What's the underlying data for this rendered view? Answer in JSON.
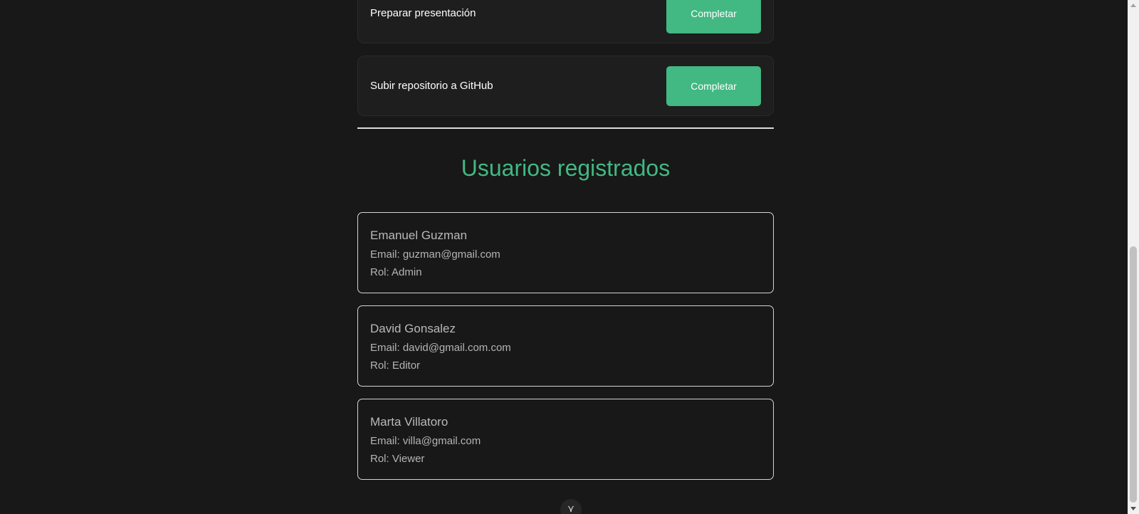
{
  "tasks": [
    {
      "label": "Preparar presentación",
      "button": "Completar"
    },
    {
      "label": "Subir repositorio a GitHub",
      "button": "Completar"
    }
  ],
  "users_section": {
    "title": "Usuarios registrados",
    "users": [
      {
        "name": "Emanuel Guzman",
        "email": "Email: guzman@gmail.com",
        "role": "Rol: Admin"
      },
      {
        "name": "David Gonsalez",
        "email": "Email: david@gmail.com.com",
        "role": "Rol: Editor"
      },
      {
        "name": "Marta Villatoro",
        "email": "Email: villa@gmail.com",
        "role": "Rol: Viewer"
      }
    ]
  },
  "scroll_button": {
    "icon": "chevron-down-icon",
    "glyph": "⋎"
  },
  "colors": {
    "background": "#181818",
    "accent": "#42b883",
    "card_border": "#d4d4d4"
  }
}
